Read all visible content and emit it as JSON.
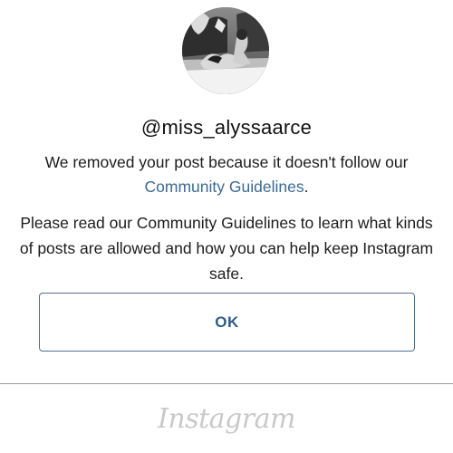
{
  "dialog": {
    "username": "@miss_alyssaarce",
    "message_line1_prefix": "We removed your post because it doesn't follow our",
    "message_link": "Community Guidelines",
    "message_line1_suffix": ".",
    "message_line2": "Please read our Community Guidelines to learn what kinds of posts are allowed and how you can help keep Instagram safe.",
    "ok_label": "OK"
  },
  "footer": {
    "logo_text": "Instagram"
  },
  "colors": {
    "link": "#3d6a91",
    "button_border": "#50708f",
    "button_text": "#2f5b82",
    "logo": "#c9c9c9"
  },
  "icons": {
    "avatar": "profile-photo"
  }
}
